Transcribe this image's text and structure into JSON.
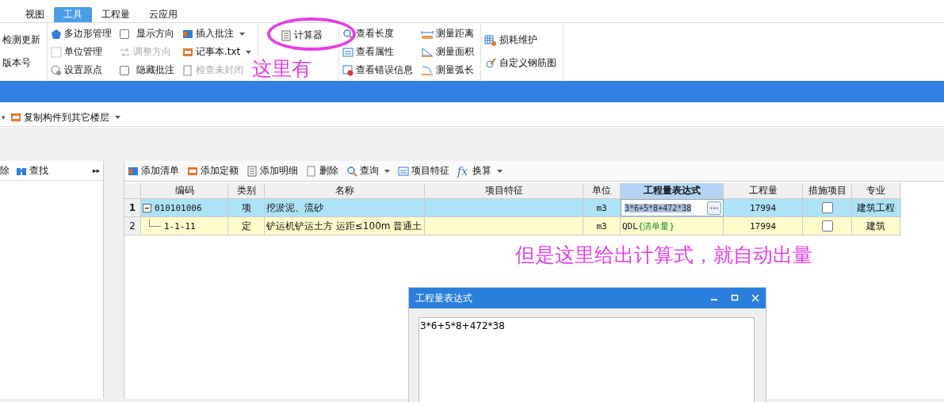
{
  "tabs": [
    {
      "label": "视图",
      "selected": false
    },
    {
      "label": "工具",
      "selected": true
    },
    {
      "label": "工程量",
      "selected": false
    },
    {
      "label": "云应用",
      "selected": false
    }
  ],
  "ribbon": {
    "groups": [
      {
        "columns": [
          {
            "items": [
              {
                "kind": "text",
                "label": "检测更新"
              },
              {
                "kind": "text",
                "label": "版本号"
              }
            ]
          }
        ]
      },
      {
        "columns": [
          {
            "items": [
              {
                "kind": "tool",
                "label": "多边形管理"
              },
              {
                "kind": "tool",
                "label": "单位管理"
              },
              {
                "kind": "tool",
                "label": "设置原点"
              }
            ]
          },
          {
            "items": [
              {
                "kind": "checkbox",
                "label": "显示方向",
                "checked": false
              },
              {
                "kind": "tool",
                "label": "调整方向",
                "disabled": true
              },
              {
                "kind": "checkbox",
                "label": "隐藏批注",
                "checked": false
              }
            ]
          },
          {
            "items": [
              {
                "kind": "tool",
                "label": "插入批注",
                "dropdown": true
              },
              {
                "kind": "tool",
                "label": "记事本.txt",
                "dropdown": true
              },
              {
                "kind": "tool",
                "label": "检查未封闭",
                "disabled": true
              }
            ]
          }
        ]
      },
      {
        "columns": [
          {
            "items": [
              {
                "kind": "tool",
                "label": "计算器"
              }
            ]
          }
        ]
      },
      {
        "columns": [
          {
            "items": [
              {
                "kind": "tool",
                "label": "查看长度"
              },
              {
                "kind": "tool",
                "label": "查看属性"
              },
              {
                "kind": "tool",
                "label": "查看错误信息"
              }
            ]
          },
          {
            "items": [
              {
                "kind": "tool",
                "label": "测量距离"
              },
              {
                "kind": "tool",
                "label": "测量面积"
              },
              {
                "kind": "tool",
                "label": "测量弧长"
              }
            ]
          }
        ]
      },
      {
        "columns": [
          {
            "items": [
              {
                "kind": "tool",
                "label": "损耗维护"
              },
              {
                "kind": "tool",
                "label": "自定义钢筋图"
              }
            ]
          }
        ]
      }
    ]
  },
  "layer_toolbar": {
    "caret": "▾",
    "copy_button": "复制构件到其它楼层",
    "copy_dropdown": true
  },
  "left_panel": {
    "delete_label": "除",
    "find_button": "查找",
    "expand": "▸▸"
  },
  "table_toolbar": [
    {
      "label": "添加清单"
    },
    {
      "label": "添加定额"
    },
    {
      "label": "添加明细"
    },
    {
      "label": "删除"
    },
    {
      "label": "查询",
      "dropdown": true
    },
    {
      "label": "项目特征"
    },
    {
      "label": "换算",
      "dropdown": true,
      "icon_text": "fx"
    }
  ],
  "table": {
    "columns": [
      {
        "label": "编码",
        "selected": false
      },
      {
        "label": "类别",
        "selected": false
      },
      {
        "label": "名称",
        "selected": false
      },
      {
        "label": "项目特征",
        "selected": false
      },
      {
        "label": "单位",
        "selected": false
      },
      {
        "label": "工程量表达式",
        "selected": true
      },
      {
        "label": "工程量",
        "selected": false
      },
      {
        "label": "措施项目",
        "selected": false
      },
      {
        "label": "专业",
        "selected": false
      }
    ],
    "rows": [
      {
        "number": "1",
        "code": "010101006",
        "expanded": true,
        "type": "项",
        "name": "挖淤泥、流砂",
        "unit": "m3",
        "expression": "3*6+5*8+472*38",
        "editing": true,
        "quantity": "17994",
        "measure": false,
        "specialty": "建筑工程",
        "selected": true,
        "children": [
          {
            "number": "2",
            "code": "1-1-11",
            "type": "定",
            "name": "铲运机铲运土方 运距≤100m 普通土",
            "unit": "m3",
            "expression": "QDL",
            "expression_note": "{清单量}",
            "editing": false,
            "quantity": "17994",
            "measure": false,
            "specialty": "建筑",
            "selected": false
          }
        ]
      }
    ]
  },
  "annotations": [
    {
      "text": "这里有"
    },
    {
      "text": "但是这里给出计算式，就自动出量"
    }
  ],
  "dialog": {
    "title": "工程量表达式",
    "value": "3*6+5*8+472*38"
  }
}
